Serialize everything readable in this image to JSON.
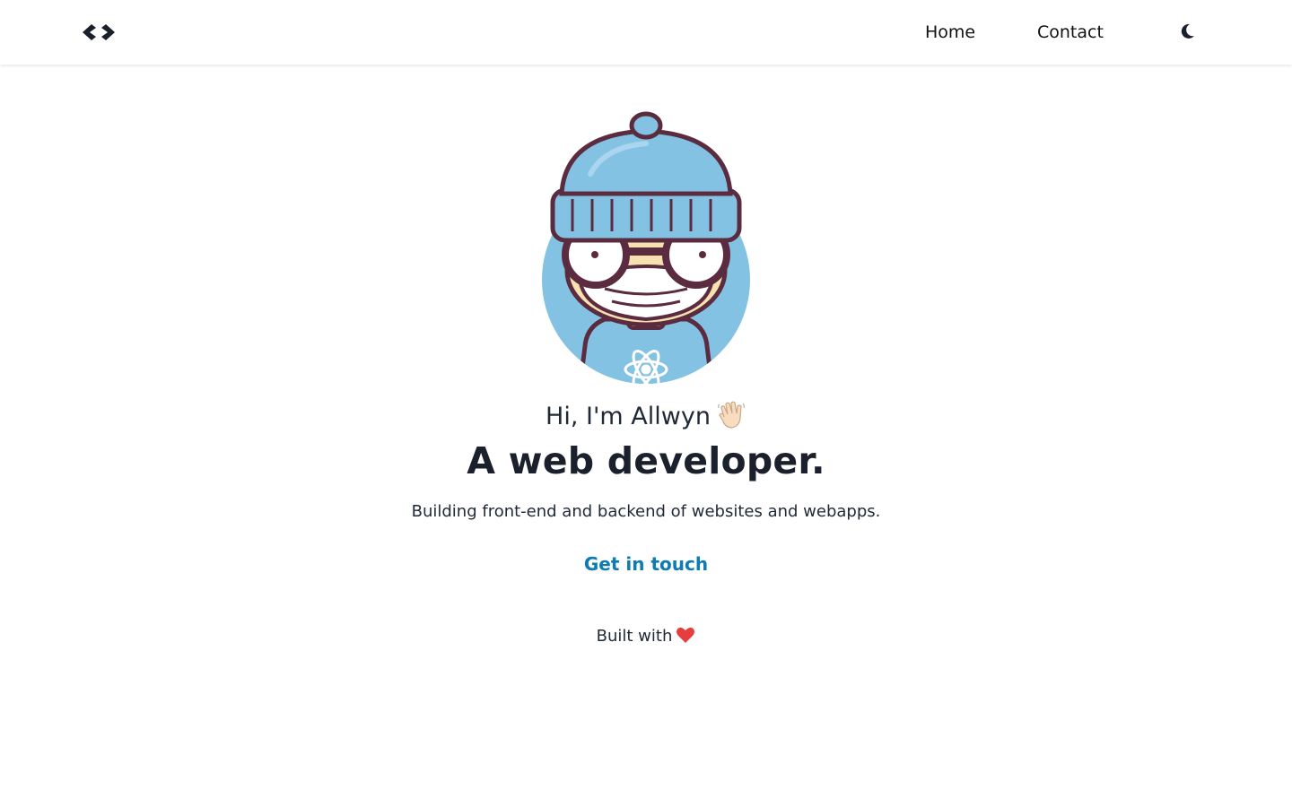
{
  "nav": {
    "logo_icon": "code-brackets-icon",
    "links": [
      {
        "label": "Home"
      },
      {
        "label": "Contact"
      }
    ],
    "theme_toggle_icon": "moon-icon"
  },
  "hero": {
    "avatar_icon": "developer-avatar-illustration",
    "greeting": "Hi, I'm Allwyn",
    "greeting_icon": "waving-hand-icon",
    "headline": "A web developer.",
    "subtext": "Building front-end and backend of websites and webapps.",
    "cta_label": "Get in touch"
  },
  "footer": {
    "text": "Built with",
    "icon": "heart-icon"
  },
  "colors": {
    "accent": "#0e7cb3",
    "text_dark": "#1a202c",
    "avatar_bg": "#84c2e4",
    "heart": "#e53e3e"
  }
}
